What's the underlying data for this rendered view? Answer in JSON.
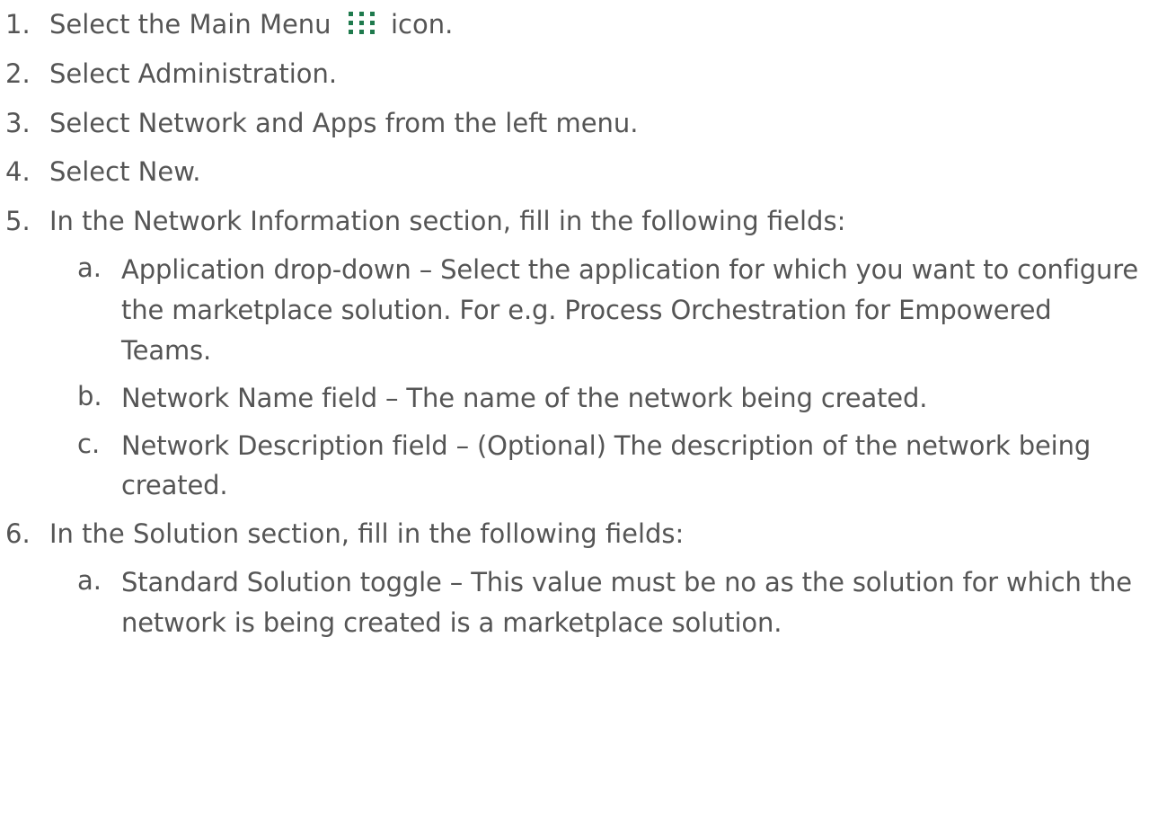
{
  "steps": [
    {
      "num": "1.",
      "text_before": "Select the Main Menu",
      "icon": "main-menu-grid-icon",
      "text_after": "icon."
    },
    {
      "num": "2.",
      "text": "Select Administration."
    },
    {
      "num": "3.",
      "text": "Select Network and Apps from the left menu."
    },
    {
      "num": "4.",
      "text": "Select New."
    },
    {
      "num": "5.",
      "text": "In the Network Information section, fill in the following fields:",
      "substeps": [
        {
          "num": "a.",
          "text": "Application drop-down – Select the application for which you want to configure the marketplace solution. For e.g. Process Orchestration for Empowered Teams."
        },
        {
          "num": "b.",
          "text": "Network Name field – The name of the network being created."
        },
        {
          "num": "c.",
          "text": "Network Description field – (Optional) The description of the network being created."
        }
      ]
    },
    {
      "num": "6.",
      "text": "In the Solution section, fill in the following fields:",
      "substeps": [
        {
          "num": "a.",
          "text": "Standard Solution toggle – This value must be no as the solution for which the network is being created is a marketplace solution."
        }
      ]
    }
  ],
  "colors": {
    "text": "#555555",
    "icon": "#1f7a4d"
  }
}
